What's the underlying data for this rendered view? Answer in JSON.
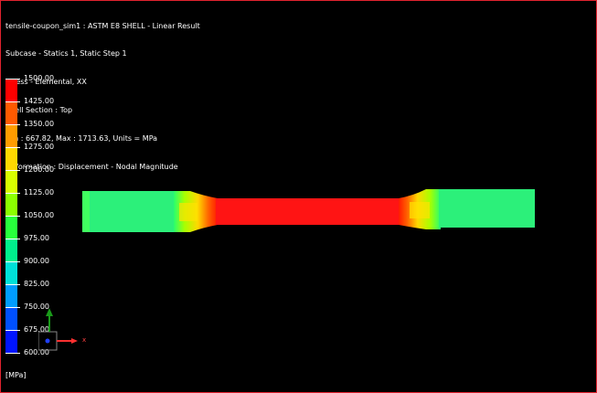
{
  "header": {
    "lines": [
      "tensile-coupon_sim1 : ASTM E8 SHELL - Linear Result",
      "Subcase - Statics 1, Static Step 1",
      "Stress - Elemental, XX",
      "Shell Section : Top",
      "Min : 667.82, Max : 1713.63, Units = MPa",
      "Deformation : Displacement - Nodal Magnitude"
    ]
  },
  "legend": {
    "labels": [
      "1500.00",
      "1425.00",
      "1350.00",
      "1275.00",
      "1200.00",
      "1125.00",
      "1050.00",
      "975.00",
      "900.00",
      "825.00",
      "750.00",
      "675.00",
      "600.00"
    ],
    "colors": [
      "#ff0000",
      "#ff5a00",
      "#ff9c00",
      "#ffd800",
      "#d8ff00",
      "#8cff00",
      "#28ff3c",
      "#00f08c",
      "#00e0d8",
      "#009cff",
      "#0050ff",
      "#0014ff"
    ],
    "units": "[MPa]"
  },
  "triad": {
    "x_label": "x"
  },
  "colors": {
    "frame": "#e0232e",
    "background": "#000000"
  }
}
